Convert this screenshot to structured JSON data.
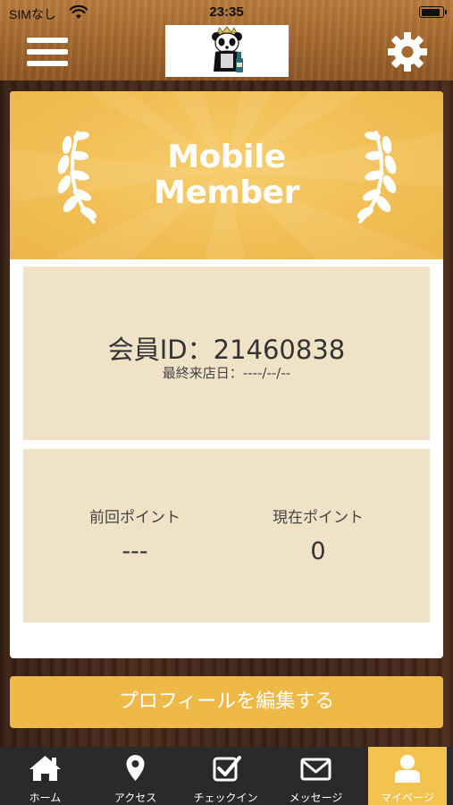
{
  "status_bar": {
    "carrier": "SIMなし",
    "time": "23:35"
  },
  "header": {
    "menu_icon": "hamburger-menu-icon",
    "logo": "panda-logo",
    "settings_icon": "gear-icon"
  },
  "card": {
    "banner_title_line1": "Mobile",
    "banner_title_line2": "Member",
    "member_id": "会員ID：21460838",
    "last_visit": "最終来店日：----/--/--",
    "prev_points_label": "前回ポイント",
    "prev_points_value": "---",
    "current_points_label": "現在ポイント",
    "current_points_value": "0"
  },
  "edit_profile_label": "プロフィールを編集する",
  "tabs": [
    {
      "label": "ホーム",
      "icon": "home-icon"
    },
    {
      "label": "アクセス",
      "icon": "map-pin-icon"
    },
    {
      "label": "チェックイン",
      "icon": "checkbox-icon"
    },
    {
      "label": "メッセージ",
      "icon": "envelope-icon"
    },
    {
      "label": "マイページ",
      "icon": "user-icon"
    }
  ],
  "colors": {
    "accent": "#efb948",
    "banner": "#f1bf55",
    "info_box": "#efe2c6",
    "tab_bar": "#2a2a2a",
    "active_tab": "#f3c34f"
  }
}
